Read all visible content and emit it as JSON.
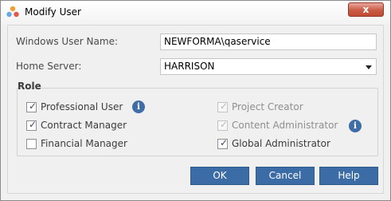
{
  "window": {
    "title": "Modify User",
    "close_glyph": "x"
  },
  "form": {
    "windows_user_label": "Windows User Name:",
    "windows_user_value": "NEWFORMA\\qaservice",
    "home_server_label": "Home Server:",
    "home_server_value": "HARRISON"
  },
  "role": {
    "title": "Role",
    "left": [
      {
        "label": "Professional User",
        "checked": true,
        "enabled": true,
        "info": true
      },
      {
        "label": "Contract Manager",
        "checked": true,
        "enabled": true,
        "info": false
      },
      {
        "label": "Financial Manager",
        "checked": false,
        "enabled": true,
        "info": false
      }
    ],
    "right": [
      {
        "label": "Project Creator",
        "checked": true,
        "enabled": false,
        "info": false
      },
      {
        "label": "Content Administrator",
        "checked": true,
        "enabled": false,
        "info": true
      },
      {
        "label": "Global Administrator",
        "checked": true,
        "enabled": true,
        "info": false
      }
    ]
  },
  "buttons": {
    "ok": "OK",
    "cancel": "Cancel",
    "help": "Help"
  },
  "colors": {
    "accent": "#3b6ca6",
    "close": "#c95b45",
    "info": "#3f6da8"
  },
  "icons": {
    "app": "users-app-icon",
    "info": "info-icon",
    "dropdown": "chevron-down-icon"
  }
}
